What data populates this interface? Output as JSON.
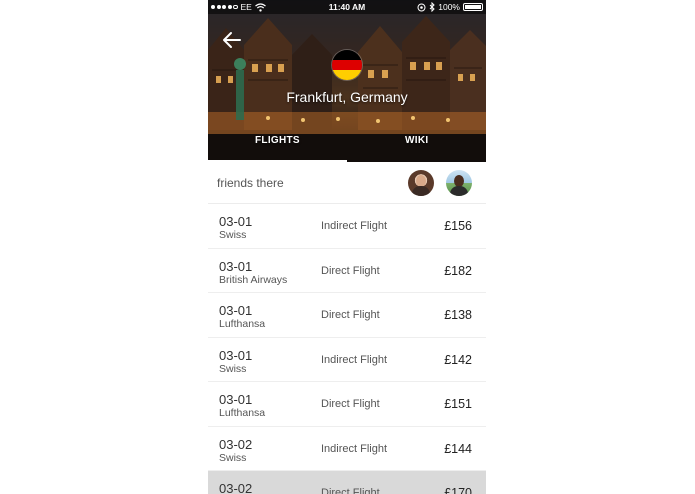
{
  "status_bar": {
    "carrier": "EE",
    "time": "11:40 AM",
    "battery": "100%",
    "battery_level": 1.0,
    "signal_bars_filled": 4,
    "signal_bars_total": 5
  },
  "header": {
    "city": "Frankfurt, Germany",
    "back_icon": "arrow-left-icon",
    "flag_icon": "germany-flag-icon",
    "flag_colors": [
      "#000000",
      "#DD0000",
      "#FFCE00"
    ]
  },
  "tabs": [
    {
      "label": "FLIGHTS",
      "active": true
    },
    {
      "label": "WIKI",
      "active": false
    }
  ],
  "friends": {
    "label": "friends there",
    "count": 2
  },
  "flights": [
    {
      "date": "03-01",
      "airline": "Swiss",
      "type": "Indirect Flight",
      "price": "£156"
    },
    {
      "date": "03-01",
      "airline": "British Airways",
      "type": "Direct Flight",
      "price": "£182"
    },
    {
      "date": "03-01",
      "airline": "Lufthansa",
      "type": "Direct Flight",
      "price": "£138"
    },
    {
      "date": "03-01",
      "airline": "Swiss",
      "type": "Indirect Flight",
      "price": "£142"
    },
    {
      "date": "03-01",
      "airline": "Lufthansa",
      "type": "Direct Flight",
      "price": "£151"
    },
    {
      "date": "03-02",
      "airline": "Swiss",
      "type": "Indirect Flight",
      "price": "£144"
    },
    {
      "date": "03-02",
      "airline": "",
      "type": "Direct Flight",
      "price": "£170",
      "selected": true
    }
  ]
}
